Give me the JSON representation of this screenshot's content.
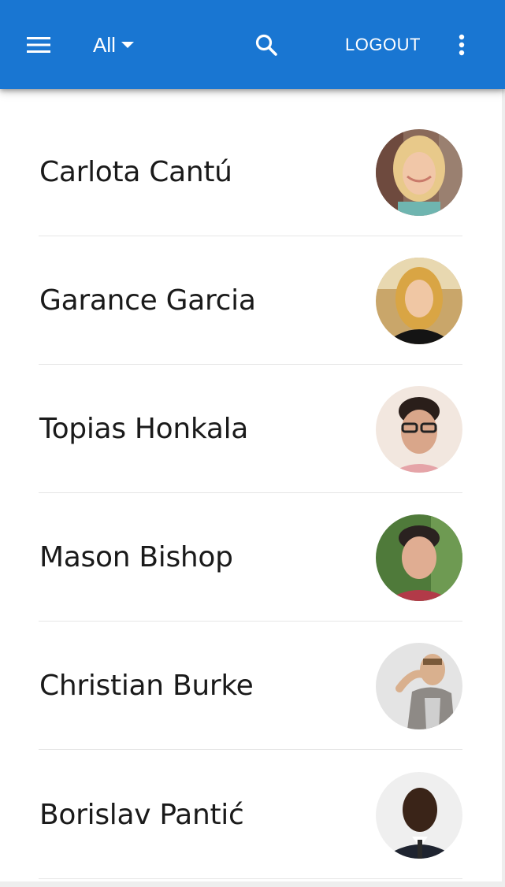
{
  "appbar": {
    "menu_icon": "hamburger-menu-icon",
    "filter_label": "All",
    "filter_icon": "caret-down-icon",
    "search_icon": "search-icon",
    "logout_label": "LOGOUT",
    "more_icon": "more-vertical-icon"
  },
  "contacts": [
    {
      "name": "Carlota Cantú"
    },
    {
      "name": "Garance Garcia"
    },
    {
      "name": "Topias Honkala"
    },
    {
      "name": "Mason Bishop"
    },
    {
      "name": "Christian Burke"
    },
    {
      "name": "Borislav Pantić"
    }
  ],
  "colors": {
    "primary": "#1976d2",
    "text": "#1a1a1a",
    "divider": "#e6e6e6"
  }
}
